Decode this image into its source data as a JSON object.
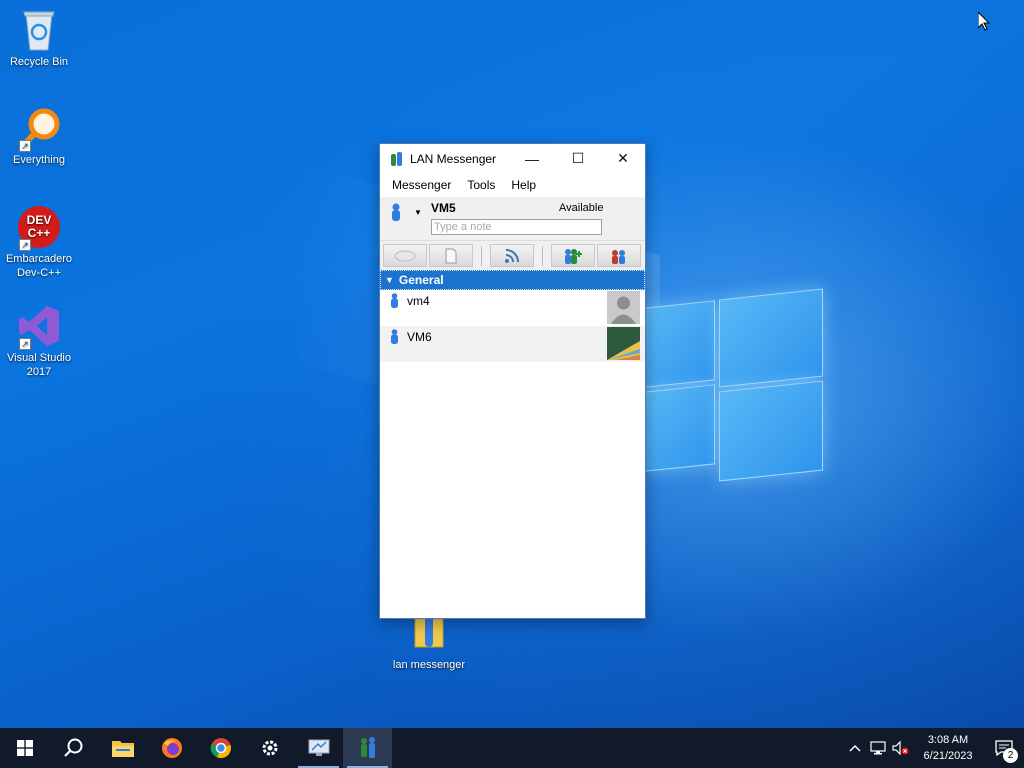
{
  "desktop": {
    "icons": [
      {
        "label": "Recycle Bin"
      },
      {
        "label": "Everything"
      },
      {
        "label": "Embarcadero Dev-C++",
        "logo_text_1": "DEV",
        "logo_text_2": "C++"
      },
      {
        "label": "Visual Studio 2017"
      },
      {
        "label": "lan messenger"
      }
    ]
  },
  "window": {
    "title": "LAN Messenger",
    "controls": {
      "minimize": "—",
      "maximize": "☐",
      "close": "✕"
    },
    "menu": [
      "Messenger",
      "Tools",
      "Help"
    ],
    "status": {
      "user_name": "VM5",
      "availability": "Available",
      "note_placeholder": "Type a note"
    },
    "toolbar_icons": [
      "chat-bubble-icon",
      "file-transfer-icon",
      "broadcast-icon",
      "add-contact-icon",
      "group-chat-icon"
    ],
    "group": {
      "name": "General",
      "contacts": [
        {
          "name": "vm4"
        },
        {
          "name": "VM6"
        }
      ]
    }
  },
  "taskbar": {
    "items": [
      "windows-start",
      "search",
      "file-explorer",
      "firefox",
      "chrome",
      "settings",
      "remote-desktop",
      "lan-messenger"
    ],
    "clock_time": "3:08 AM",
    "clock_date": "6/21/2023",
    "notification_count": "2"
  },
  "colors": {
    "accent": "#1b75d0",
    "taskbar": "#101a2a",
    "desktop": "#0a6fd8"
  }
}
